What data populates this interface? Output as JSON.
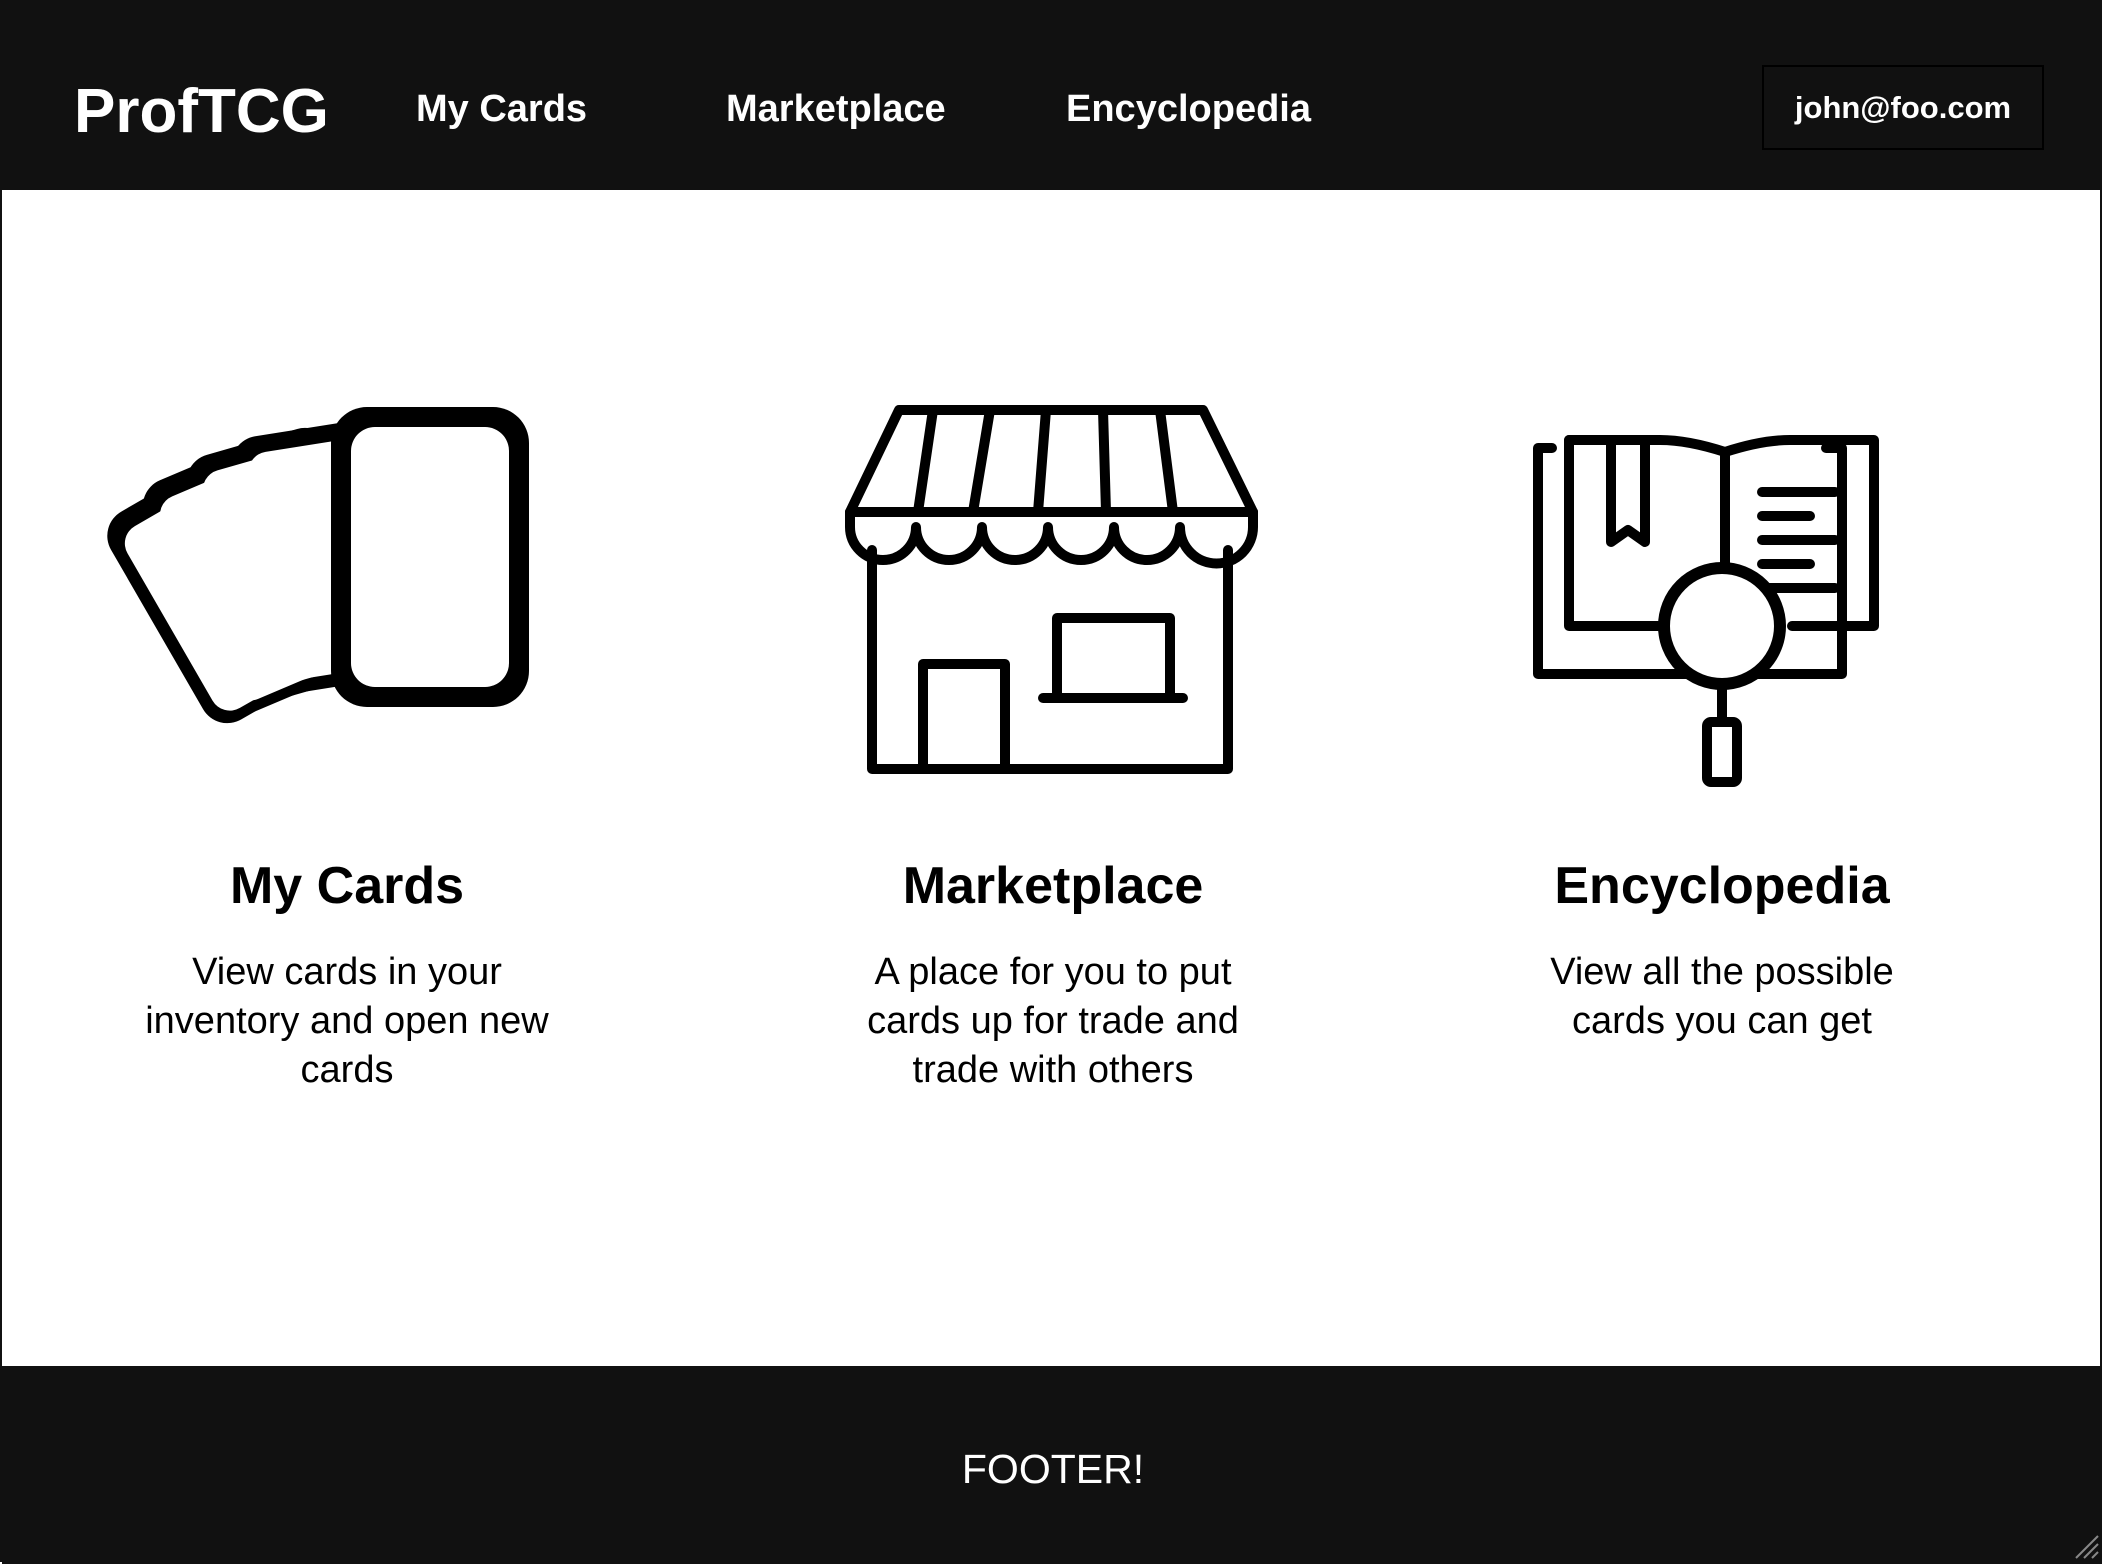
{
  "header": {
    "logo": "ProfTCG",
    "nav": {
      "my_cards": "My Cards",
      "marketplace": "Marketplace",
      "encyclopedia": "Encyclopedia"
    },
    "user_email": "john@foo.com"
  },
  "features": [
    {
      "icon": "cards-fan-icon",
      "title": "My Cards",
      "description": "View cards in your inventory and open new cards"
    },
    {
      "icon": "storefront-icon",
      "title": "Marketplace",
      "description": "A place for you to put cards up for trade and trade with others"
    },
    {
      "icon": "book-search-icon",
      "title": "Encyclopedia",
      "description": "View all the possible cards you can get"
    }
  ],
  "footer": {
    "text": "FOOTER!"
  },
  "colors": {
    "header_bg": "#111111",
    "footer_bg": "#111111",
    "page_bg": "#ffffff",
    "text_light": "#ffffff",
    "text_dark": "#000000"
  }
}
